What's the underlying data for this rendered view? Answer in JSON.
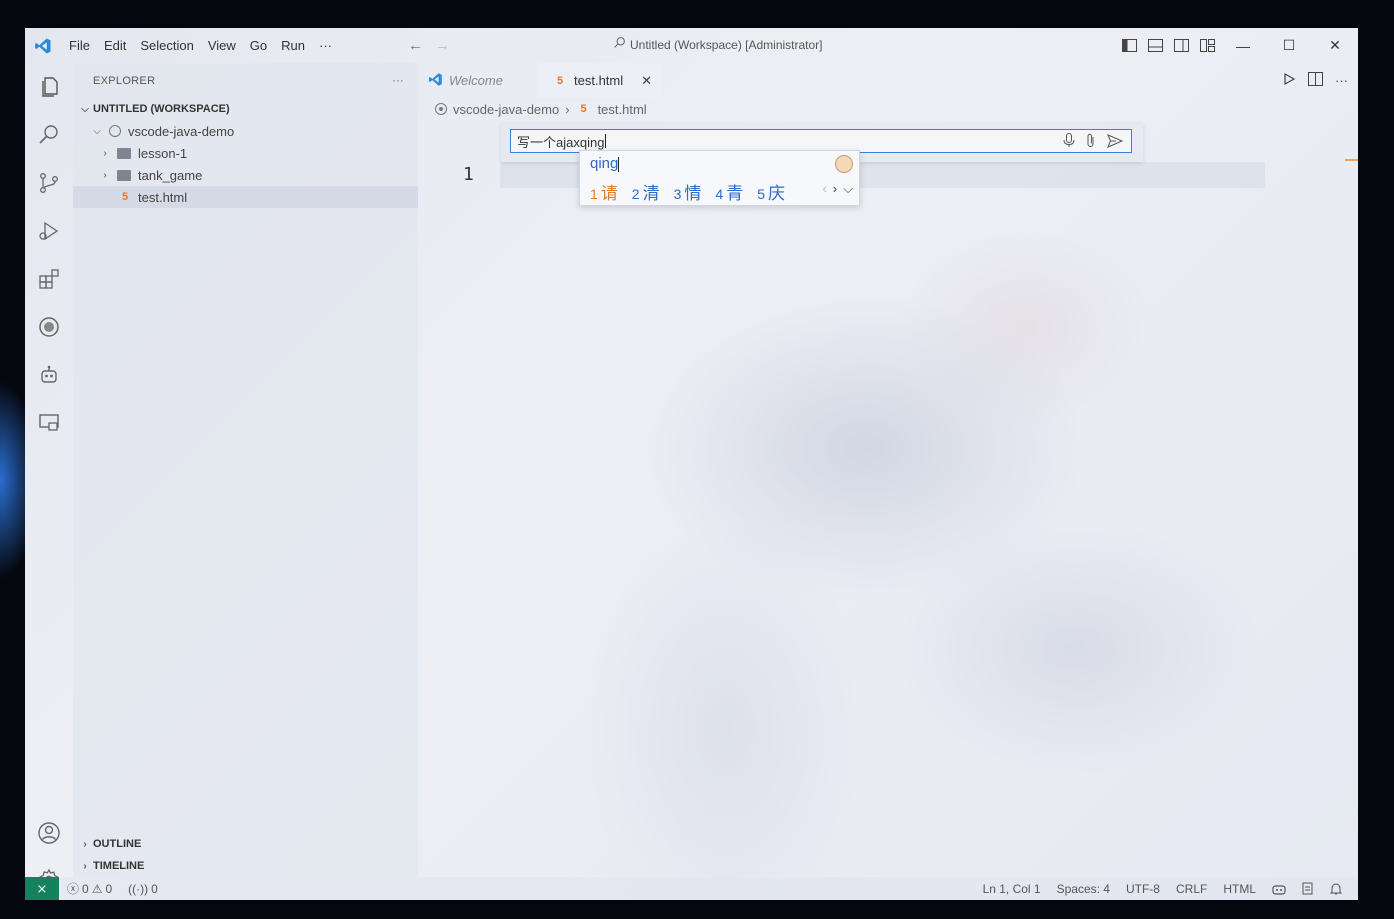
{
  "titlebar": {
    "menu": [
      "File",
      "Edit",
      "Selection",
      "View",
      "Go",
      "Run",
      "···"
    ],
    "title": "Untitled (Workspace) [Administrator]"
  },
  "sidebar": {
    "header": "EXPLORER",
    "more": "···",
    "workspace": "UNTITLED (WORKSPACE)",
    "root_folder": "vscode-java-demo",
    "items": [
      {
        "label": "lesson-1",
        "type": "folder"
      },
      {
        "label": "tank_game",
        "type": "folder"
      },
      {
        "label": "test.html",
        "type": "html"
      }
    ],
    "outline": "OUTLINE",
    "timeline": "TIMELINE"
  },
  "tabs": [
    {
      "label": "Welcome"
    },
    {
      "label": "test.html"
    }
  ],
  "breadcrumb": [
    "vscode-java-demo",
    "test.html"
  ],
  "editor": {
    "line_number": "1"
  },
  "chat": {
    "input_text": "写一个ajaxqing"
  },
  "ime": {
    "pinyin": "qing",
    "candidates": [
      {
        "num": "1",
        "char": "请"
      },
      {
        "num": "2",
        "char": "清"
      },
      {
        "num": "3",
        "char": "情"
      },
      {
        "num": "4",
        "char": "青"
      },
      {
        "num": "5",
        "char": "庆"
      }
    ]
  },
  "statusbar": {
    "errors": "0",
    "warnings": "0",
    "ports": "0",
    "position": "Ln 1, Col 1",
    "spaces": "Spaces: 4",
    "encoding": "UTF-8",
    "eol": "CRLF",
    "language": "HTML"
  },
  "colors": {
    "accent": "#3c7fd6",
    "remote": "#16825d",
    "html_icon": "#e37933",
    "ime_first": "#e07b28",
    "ime_text": "#2a6ac8"
  }
}
